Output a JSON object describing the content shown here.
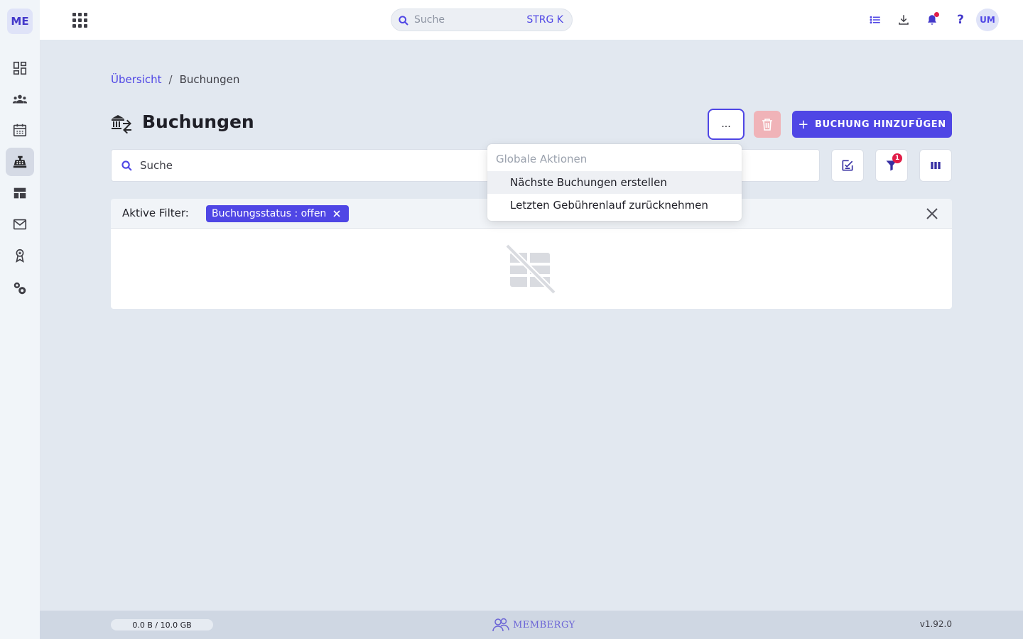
{
  "sidebar": {
    "org_initials": "ME",
    "items": [
      {
        "name": "dashboard-icon"
      },
      {
        "name": "members-icon"
      },
      {
        "name": "calendar-icon"
      },
      {
        "name": "cash-register-icon",
        "active": true
      },
      {
        "name": "table-layout-icon"
      },
      {
        "name": "mail-icon"
      },
      {
        "name": "badge-icon"
      },
      {
        "name": "settings-gears-icon"
      }
    ]
  },
  "topbar": {
    "search_placeholder": "Suche",
    "search_shortcut": "STRG K",
    "help_label": "?",
    "user_initials": "UM"
  },
  "breadcrumb": {
    "home": "Übersicht",
    "separator": "/",
    "current": "Buchungen"
  },
  "page": {
    "title": "Buchungen",
    "more_label": "...",
    "add_button_label": "BUCHUNG HINZUFÜGEN"
  },
  "table_search": {
    "placeholder": "Suche"
  },
  "filters": {
    "label": "Aktive Filter:",
    "active_count": "1",
    "chips": [
      {
        "label": "Buchungsstatus : offen"
      }
    ]
  },
  "dropdown": {
    "header": "Globale Aktionen",
    "items": [
      {
        "label": "Nächste Buchungen erstellen"
      },
      {
        "label": "Letzten Gebührenlauf zurücknehmen"
      }
    ]
  },
  "footer": {
    "storage": "0.0 B / 10.0 GB",
    "brand": "MEMBERGY",
    "version": "v1.92.0"
  },
  "colors": {
    "accent": "#4f46e5",
    "danger_disabled": "#f0b3b8",
    "notification": "#e11d48"
  }
}
